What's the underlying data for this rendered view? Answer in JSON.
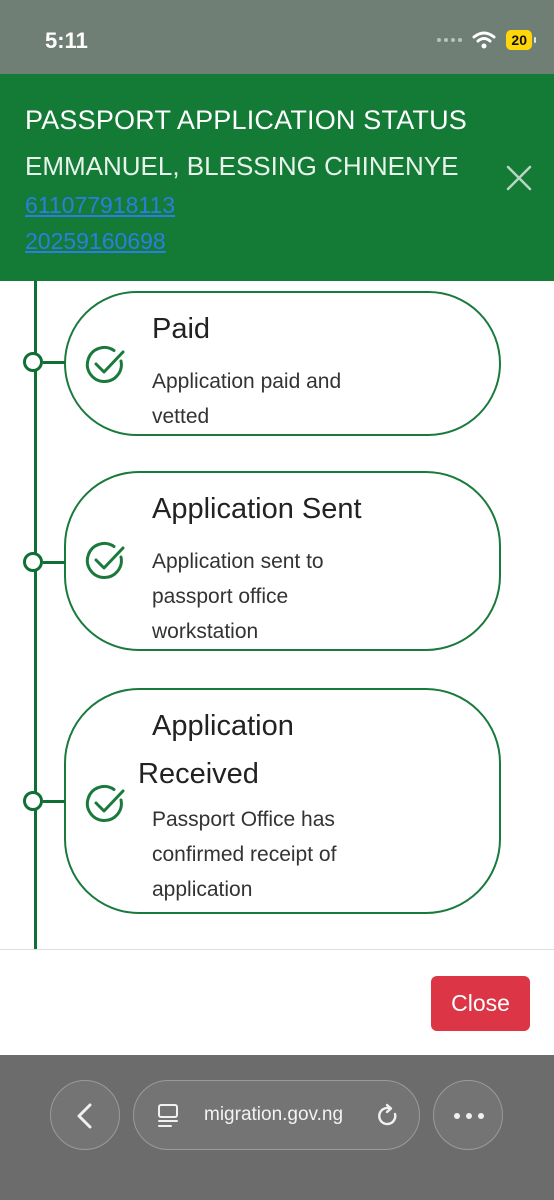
{
  "status_bar": {
    "time": "5:11",
    "battery": "20"
  },
  "header": {
    "title": "PASSPORT APPLICATION STATUS",
    "name": "EMMANUEL, BLESSING CHINENYE",
    "link1": "611077918113",
    "link2": "20259160698"
  },
  "timeline": [
    {
      "title": "Paid",
      "title_line2": "",
      "desc_lines": [
        "Application paid and",
        "vetted",
        ""
      ]
    },
    {
      "title": "Application Sent",
      "title_line2": "",
      "desc_lines": [
        "Application sent to",
        "passport office",
        "workstation"
      ]
    },
    {
      "title": "Application",
      "title_line2": "Received",
      "desc_lines": [
        "Passport Office has",
        "confirmed receipt of",
        "application"
      ]
    }
  ],
  "footer": {
    "close_label": "Close"
  },
  "browser": {
    "url": "migration.gov.ng"
  },
  "colors": {
    "header_green": "#137b36",
    "timeline_green": "#0f6f35",
    "close_red": "#dc3545",
    "link_blue": "#2b7fe0"
  }
}
